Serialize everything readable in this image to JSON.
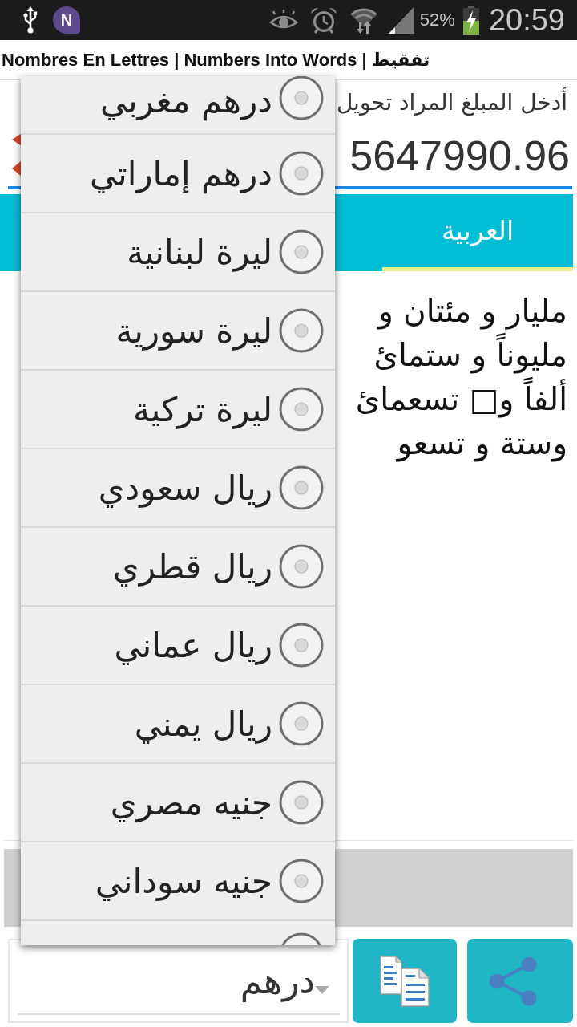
{
  "status_bar": {
    "badge": "N",
    "battery": "52%",
    "time": "20:59"
  },
  "app_bar": {
    "title": "Nombres En Lettres | Numbers Into Words | تفقيط"
  },
  "amount": {
    "label": "أدخل المبلغ المراد تحويل",
    "value": "5647990.96"
  },
  "tabs": [
    {
      "label": "العربية",
      "selected": true
    }
  ],
  "result": {
    "lines": [
      "مليار و مئتان و",
      "مليوناً و ستمائ",
      "ألفاً و□ تسعمائ",
      "وستة و تسعو"
    ]
  },
  "currency_spinner": {
    "value": "درهم"
  },
  "actions": [
    {
      "kind": "copy"
    },
    {
      "kind": "share"
    }
  ],
  "currency_menu": {
    "items": [
      {
        "label": "درهم مغربي",
        "selected": false
      },
      {
        "label": "درهم إماراتي",
        "selected": false
      },
      {
        "label": "ليرة لبنانية",
        "selected": false
      },
      {
        "label": "ليرة سورية",
        "selected": false
      },
      {
        "label": "ليرة تركية",
        "selected": false
      },
      {
        "label": "ريال سعودي",
        "selected": false
      },
      {
        "label": "ريال قطري",
        "selected": false
      },
      {
        "label": "ريال عماني",
        "selected": false
      },
      {
        "label": "ريال يمني",
        "selected": false
      },
      {
        "label": "جنيه مصري",
        "selected": false
      },
      {
        "label": "جنيه سوداني",
        "selected": false
      },
      {
        "selected": false
      }
    ]
  }
}
